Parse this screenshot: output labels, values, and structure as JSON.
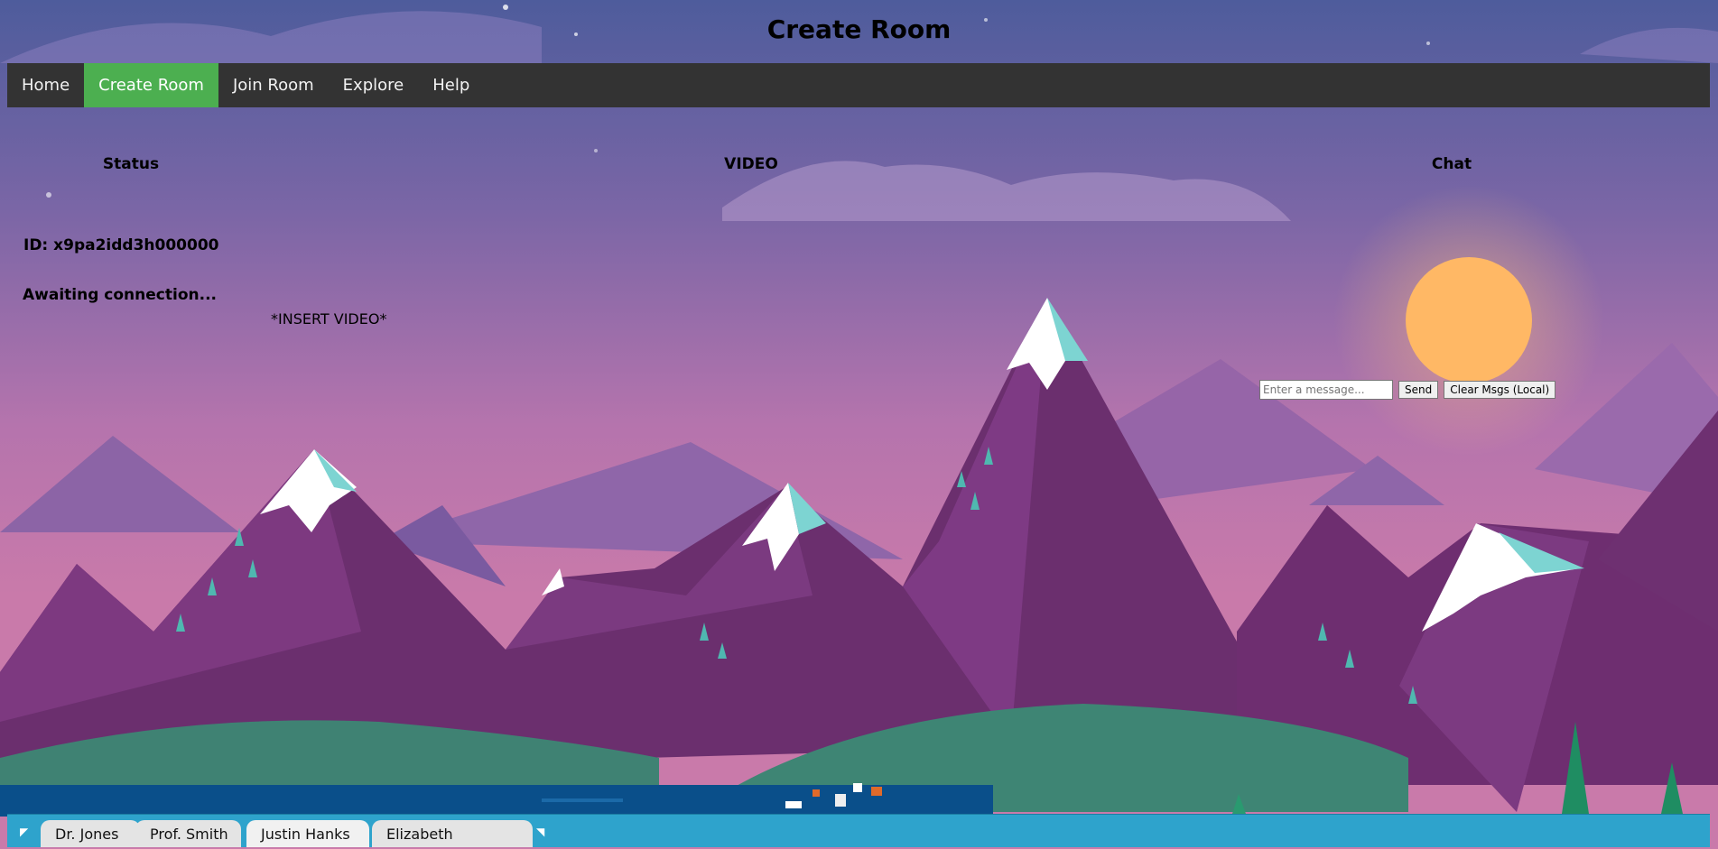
{
  "page": {
    "title": "Create Room"
  },
  "nav": {
    "items": [
      {
        "label": "Home",
        "active": false
      },
      {
        "label": "Create Room",
        "active": true
      },
      {
        "label": "Join Room",
        "active": false
      },
      {
        "label": "Explore",
        "active": false
      },
      {
        "label": "Help",
        "active": false
      }
    ]
  },
  "columns": {
    "status": "Status",
    "video": "VIDEO",
    "chat": "Chat"
  },
  "status": {
    "id_text": "ID: x9pa2idd3h000000",
    "message": "Awaiting connection..."
  },
  "video": {
    "placeholder": "*INSERT VIDEO*"
  },
  "chat": {
    "input_placeholder": "Enter a message...",
    "send_label": "Send",
    "clear_label": "Clear Msgs (Local)"
  },
  "tabs": [
    {
      "label": "Dr. Jones"
    },
    {
      "label": "Prof. Smith"
    },
    {
      "label": "Justin Hanks"
    },
    {
      "label": "Elizabeth"
    }
  ],
  "colors": {
    "nav_bg": "#333333",
    "nav_active": "#4CAF50",
    "tabbar": "#2ea3cc"
  }
}
